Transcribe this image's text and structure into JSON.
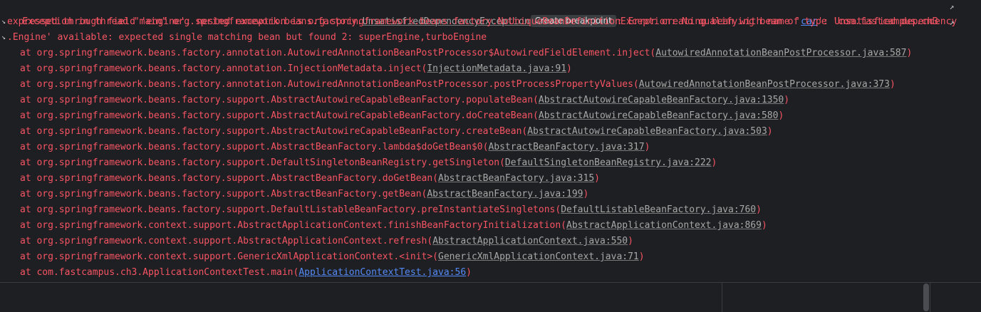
{
  "console": {
    "line1": {
      "part1": "Exception in thread \"main\" org.springframework.beans.factory.",
      "link": "UnsatisfiedDependencyException",
      "tooltip": "Create breakpoint",
      "part2": ": Error creating bean with name '",
      "bean_link": "car",
      "part3": "': Unsatisfied dependency"
    },
    "line2": "expressed through field 'engine'; nested exception is org.springframework.beans.factory.NoUniqueBeanDefinitionException: No qualifying bean of type 'com.fastcampus.ch3",
    "line3": ".Engine' available: expected single matching bean but found 2: superEngine,turboEngine",
    "frames": [
      {
        "text": "at org.springframework.beans.factory.annotation.AutowiredAnnotationBeanPostProcessor$AutowiredFieldElement.inject(",
        "link": "AutowiredAnnotationBeanPostProcessor.java:587",
        "close": ")"
      },
      {
        "text": "at org.springframework.beans.factory.annotation.InjectionMetadata.inject(",
        "link": "InjectionMetadata.java:91",
        "close": ")"
      },
      {
        "text": "at org.springframework.beans.factory.annotation.AutowiredAnnotationBeanPostProcessor.postProcessPropertyValues(",
        "link": "AutowiredAnnotationBeanPostProcessor.java:373",
        "close": ")"
      },
      {
        "text": "at org.springframework.beans.factory.support.AbstractAutowireCapableBeanFactory.populateBean(",
        "link": "AbstractAutowireCapableBeanFactory.java:1350",
        "close": ")"
      },
      {
        "text": "at org.springframework.beans.factory.support.AbstractAutowireCapableBeanFactory.doCreateBean(",
        "link": "AbstractAutowireCapableBeanFactory.java:580",
        "close": ")"
      },
      {
        "text": "at org.springframework.beans.factory.support.AbstractAutowireCapableBeanFactory.createBean(",
        "link": "AbstractAutowireCapableBeanFactory.java:503",
        "close": ")"
      },
      {
        "text": "at org.springframework.beans.factory.support.AbstractBeanFactory.lambda$doGetBean$0(",
        "link": "AbstractBeanFactory.java:317",
        "close": ")"
      },
      {
        "text": "at org.springframework.beans.factory.support.DefaultSingletonBeanRegistry.getSingleton(",
        "link": "DefaultSingletonBeanRegistry.java:222",
        "close": ")"
      },
      {
        "text": "at org.springframework.beans.factory.support.AbstractBeanFactory.doGetBean(",
        "link": "AbstractBeanFactory.java:315",
        "close": ")"
      },
      {
        "text": "at org.springframework.beans.factory.support.AbstractBeanFactory.getBean(",
        "link": "AbstractBeanFactory.java:199",
        "close": ")"
      },
      {
        "text": "at org.springframework.beans.factory.support.DefaultListableBeanFactory.preInstantiateSingletons(",
        "link": "DefaultListableBeanFactory.java:760",
        "close": ")"
      },
      {
        "text": "at org.springframework.context.support.AbstractApplicationContext.finishBeanFactoryInitialization(",
        "link": "AbstractApplicationContext.java:869",
        "close": ")"
      },
      {
        "text": "at org.springframework.context.support.AbstractApplicationContext.refresh(",
        "link": "AbstractApplicationContext.java:550",
        "close": ")"
      },
      {
        "text": "at org.springframework.context.support.GenericXmlApplicationContext.<init>(",
        "link": "GenericXmlApplicationContext.java:71",
        "close": ")"
      },
      {
        "text": "at com.fastcampus.ch3.ApplicationContextTest.main(",
        "link": "ApplicationContextTest.java:56",
        "close": ")"
      }
    ]
  },
  "icons": {
    "wrap": "soft-wrap-icon",
    "continued": "line-continuation-icon"
  },
  "colors": {
    "error_text": "#f75464",
    "gray_link": "#a8a8a8",
    "blue_link": "#548af7",
    "background": "#1e1f22"
  }
}
